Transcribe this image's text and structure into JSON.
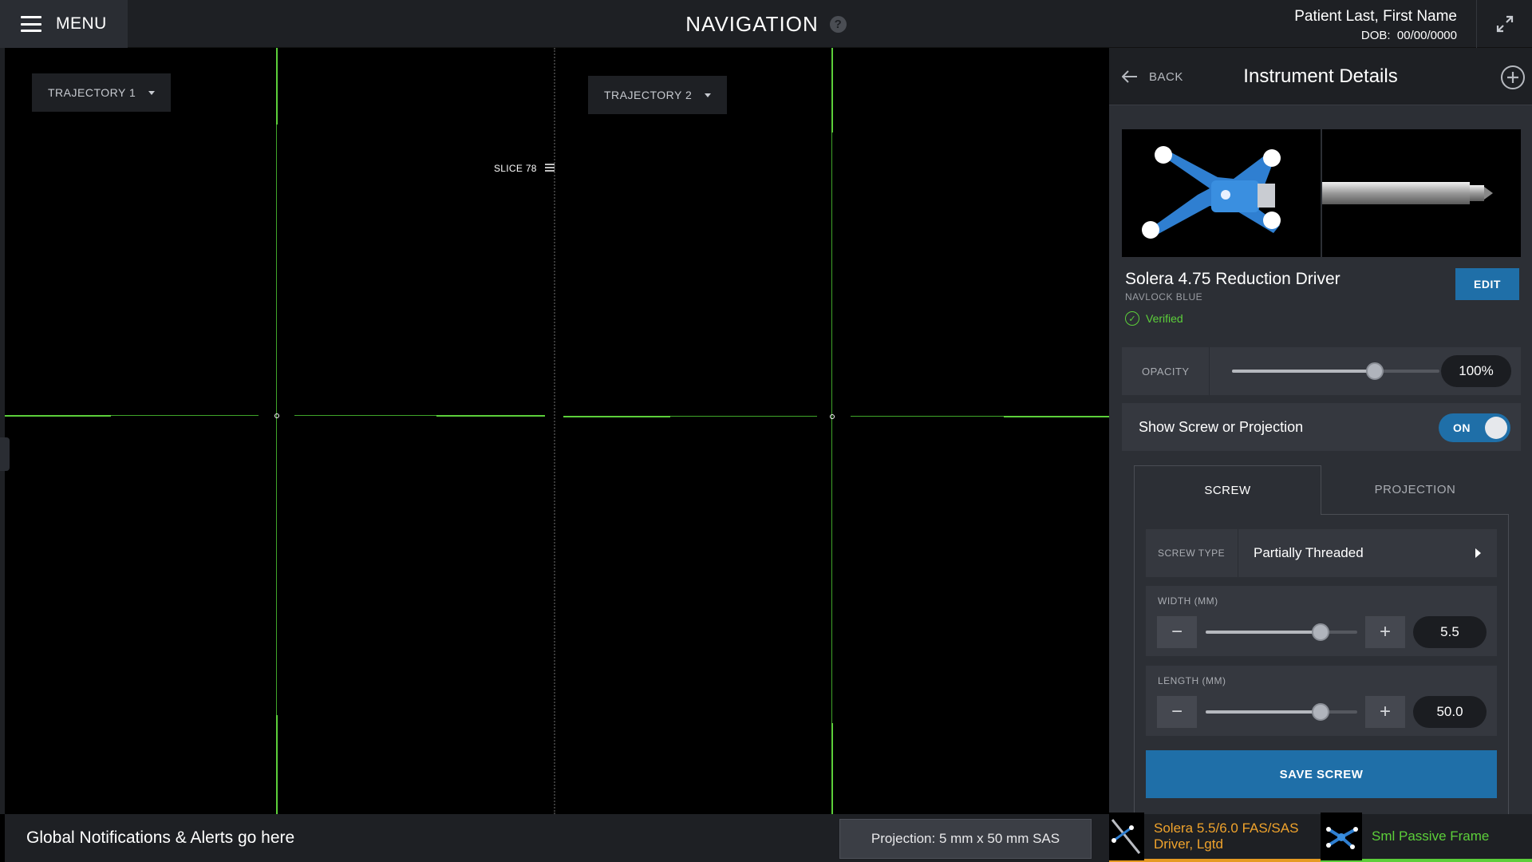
{
  "header": {
    "menu_label": "MENU",
    "title": "NAVIGATION",
    "help_glyph": "?",
    "patient_name": "Patient Last, First Name",
    "dob_label": "DOB:",
    "dob_value": "00/00/0000"
  },
  "viewer": {
    "trajectory_1": "TRAJECTORY 1",
    "trajectory_2": "TRAJECTORY 2",
    "slice_label": "SLICE 78",
    "crosshair_color": "#5ccf3a"
  },
  "bottom": {
    "notification": "Global Notifications & Alerts go here",
    "projection": "Projection: 5 mm x 50 mm SAS"
  },
  "panel": {
    "back_label": "BACK",
    "title": "Instrument Details",
    "instrument_name": "Solera 4.75 Reduction Driver",
    "instrument_sub": "NAVLOCK BLUE",
    "verified_label": "Verified",
    "edit_label": "EDIT",
    "opacity_label": "OPACITY",
    "opacity_value": "100%",
    "opacity_fraction": 0.69,
    "toggle_label": "Show Screw or Projection",
    "toggle_state": "ON",
    "tabs": [
      "SCREW",
      "PROJECTION"
    ],
    "active_tab": "SCREW",
    "screw_type_label": "SCREW TYPE",
    "screw_type_value": "Partially Threaded",
    "width_label": "WIDTH (MM)",
    "width_value": "5.5",
    "width_fraction": 0.76,
    "length_label": "LENGTH (MM)",
    "length_value": "50.0",
    "length_fraction": 0.76,
    "minus_glyph": "−",
    "plus_glyph": "+",
    "save_label": "SAVE SCREW"
  },
  "footer": {
    "item1": "Solera 5.5/6.0 FAS/SAS Driver, Lgtd",
    "item1_color": "#f0a32c",
    "item2": "Sml Passive Frame",
    "item2_color": "#5ccf3a"
  }
}
